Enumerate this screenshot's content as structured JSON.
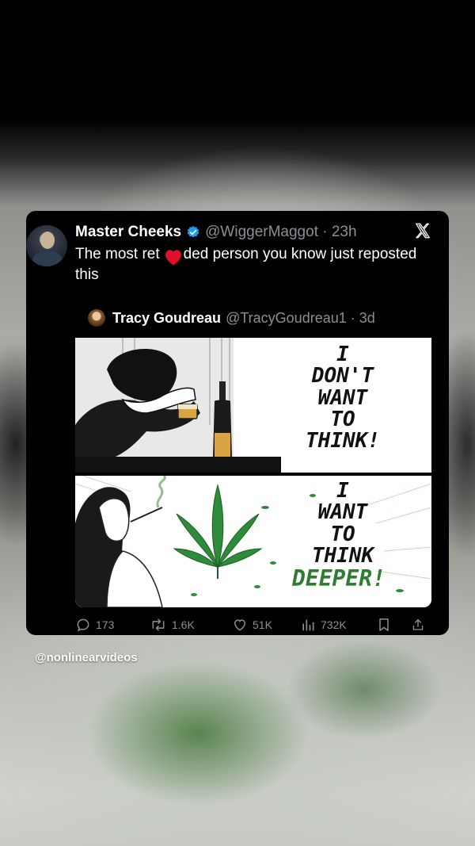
{
  "tweet": {
    "author_name": "Master Cheeks",
    "author_handle": "@WiggerMaggot",
    "time": "23h",
    "text_prefix": "The most ret",
    "text_suffix": "ded person you know just reposted this",
    "verified_color": "#1d9bf0"
  },
  "quote": {
    "author_name": "Tracy Goudreau",
    "author_handle": "@TracyGoudreau1",
    "time": "3d",
    "panel_top_lines": [
      "I",
      "DON'T",
      "WANT",
      "TO",
      "THINK!"
    ],
    "panel_bottom_lines": [
      "I",
      "WANT",
      "TO",
      "THINK"
    ],
    "panel_bottom_emphasis": "DEEPER!",
    "emphasis_color": "#2e7d32"
  },
  "actions": {
    "replies": "173",
    "reposts": "1.6K",
    "likes": "51K",
    "views": "732K"
  },
  "icons": [
    "x-logo-icon",
    "verified-badge-icon",
    "heart-sticker-icon",
    "reply-icon",
    "repost-icon",
    "like-icon",
    "views-icon",
    "bookmark-icon",
    "share-icon"
  ],
  "watermark": "@nonlinearvideos"
}
